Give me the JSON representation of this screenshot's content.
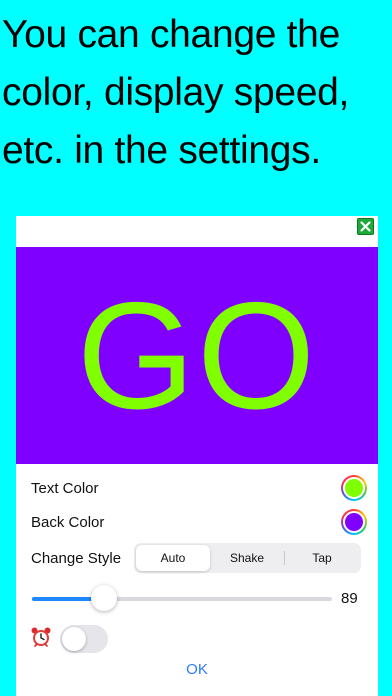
{
  "headline": "You can change the color, display speed, etc. in the settings.",
  "preview": {
    "text": "GO",
    "text_color": "#80ff00",
    "back_color": "#8000ff"
  },
  "settings": {
    "text_color_label": "Text Color",
    "text_color_value": "#80ff00",
    "back_color_label": "Back Color",
    "back_color_value": "#8000ff",
    "change_style_label": "Change Style",
    "change_style_options": [
      "Auto",
      "Shake",
      "Tap"
    ],
    "change_style_selected": "Auto",
    "speed_value": "89",
    "speed_fraction": 0.24,
    "alarm_icon": "alarm-clock-icon",
    "alarm_enabled": false,
    "ok_label": "OK"
  },
  "colors": {
    "background": "#00ffff",
    "accent": "#2c7df6",
    "close_button": "#1fa83a"
  }
}
